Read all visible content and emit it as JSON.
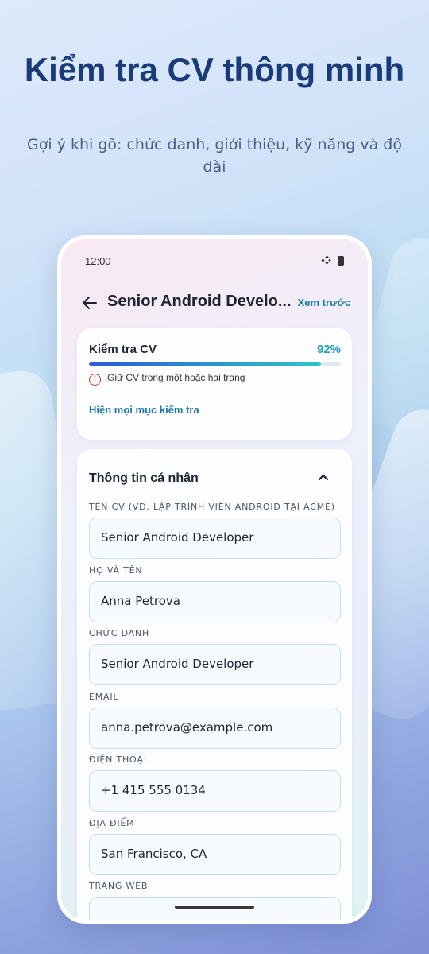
{
  "promo": {
    "headline": "Kiểm tra CV thông minh",
    "subtitle": "Gợi ý khi gõ: chức danh, giới thiệu, kỹ năng và độ dài"
  },
  "status_bar": {
    "time": "12:00",
    "icons": [
      "signal-icon",
      "battery-icon"
    ]
  },
  "app_bar": {
    "title": "Senior Android Develo...",
    "preview_label": "Xem trước",
    "back_icon": "back-arrow-icon"
  },
  "cv_check": {
    "title": "Kiểm tra CV",
    "percent_label": "92%",
    "progress": 0.92,
    "warning": "Giữ CV trong một hoặc hai trang",
    "show_all_label": "Hiện mọi mục kiểm tra"
  },
  "personal_info": {
    "section_title": "Thông tin cá nhân",
    "fields": [
      {
        "label": "TÊN CV (VD. LẬP TRÌNH VIÊN ANDROID TẠI ACME)",
        "value": "Senior Android Developer"
      },
      {
        "label": "HỌ VÀ TÊN",
        "value": "Anna Petrova"
      },
      {
        "label": "CHỨC DANH",
        "value": "Senior Android Developer"
      },
      {
        "label": "EMAIL",
        "value": "anna.petrova@example.com"
      },
      {
        "label": "ĐIỆN THOẠI",
        "value": "+1 415 555 0134"
      },
      {
        "label": "ĐỊA ĐIỂM",
        "value": "San Francisco, CA"
      },
      {
        "label": "TRANG WEB",
        "value": ""
      }
    ]
  },
  "colors": {
    "accent": "#1b7ab0",
    "percent": "#1aa0b8",
    "warning": "#c0392b",
    "headline": "#1a3b7a"
  }
}
